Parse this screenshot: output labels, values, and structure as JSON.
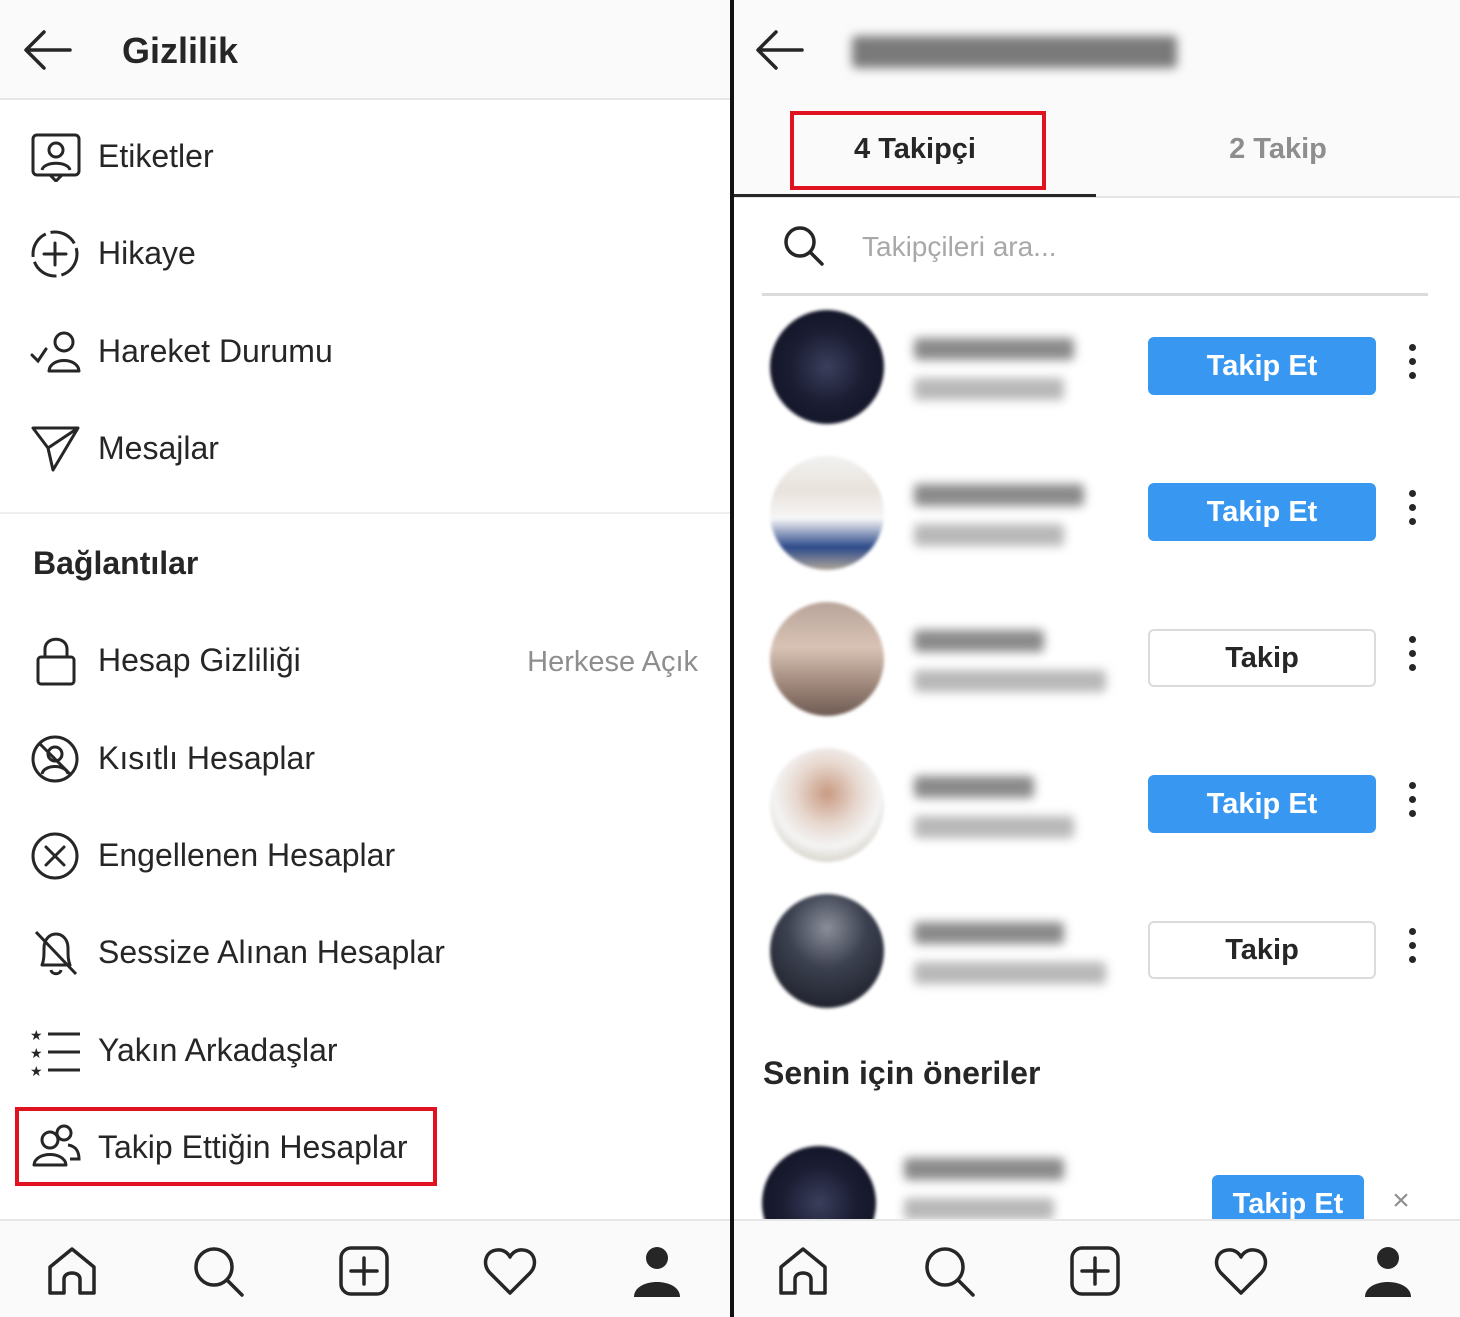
{
  "left": {
    "header": {
      "title": "Gizlilik",
      "back_icon": "arrow-left-icon"
    },
    "items": [
      {
        "label": "Etiketler",
        "icon": "tag-person-icon"
      },
      {
        "label": "Hikaye",
        "icon": "story-add-icon"
      },
      {
        "label": "Hareket Durumu",
        "icon": "activity-status-icon"
      },
      {
        "label": "Mesajlar",
        "icon": "paper-plane-icon"
      }
    ],
    "section_title": "Bağlantılar",
    "connections": [
      {
        "label": "Hesap Gizliliği",
        "value": "Herkese Açık",
        "icon": "lock-icon"
      },
      {
        "label": "Kısıtlı Hesaplar",
        "icon": "restricted-icon"
      },
      {
        "label": "Engellenen Hesaplar",
        "icon": "blocked-icon"
      },
      {
        "label": "Sessize Alınan Hesaplar",
        "icon": "muted-bell-icon"
      },
      {
        "label": "Yakın Arkadaşlar",
        "icon": "close-friends-list-icon"
      },
      {
        "label": "Takip Ettiğin Hesaplar",
        "icon": "following-people-icon"
      }
    ]
  },
  "right": {
    "tabs": [
      {
        "label": "4 Takipçi"
      },
      {
        "label": "2 Takip"
      }
    ],
    "search": {
      "placeholder": "Takipçileri ara..."
    },
    "followers": [
      {
        "button": "Takip Et",
        "style": "primary"
      },
      {
        "button": "Takip Et",
        "style": "primary"
      },
      {
        "button": "Takip",
        "style": "secondary"
      },
      {
        "button": "Takip Et",
        "style": "primary"
      },
      {
        "button": "Takip",
        "style": "secondary"
      }
    ],
    "suggestions_title": "Senin için öneriler",
    "suggestion": {
      "button": "Takip Et",
      "close": "×"
    }
  },
  "colors": {
    "accent": "#3897f0",
    "highlight": "#e0121f",
    "text": "#262626",
    "secondary_text": "#8e8e8e"
  },
  "bottom_nav": [
    "home-icon",
    "search-icon",
    "new-post-icon",
    "heart-icon",
    "profile-icon"
  ]
}
